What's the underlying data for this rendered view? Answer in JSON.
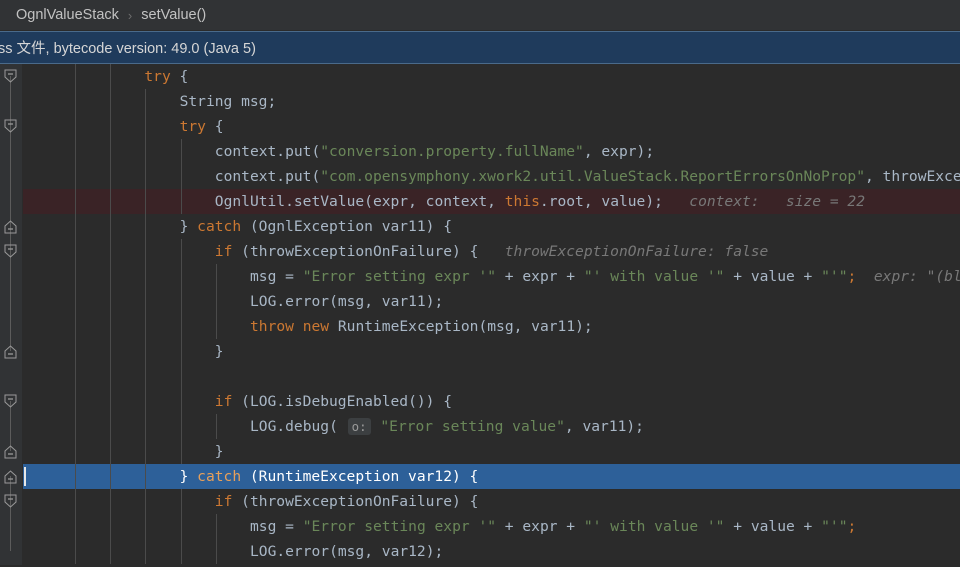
{
  "breadcrumb": {
    "name": "editor-breadcrumb",
    "items": [
      "OgnlValueStack",
      "setValue()"
    ],
    "separator": "›"
  },
  "infobar": {
    "text": "ss 文件, bytecode version: 49.0 (Java 5)",
    "background": "#1f3b5c",
    "border": "#4a6a8a"
  },
  "colors": {
    "editor_background": "#2b2b2b",
    "gutter_background": "#313335",
    "breadcrumb_background": "#313335",
    "default_text": "#a9b7c6",
    "keyword": "#cc7832",
    "string": "#6a8759",
    "number": "#6897bb",
    "inline_hint": "#787878",
    "execution_line": "#3a2326",
    "selected_line": "#2d6099",
    "indent_guide": "#4b4b4b",
    "fold_rail": "#5c5c5c"
  },
  "editor": {
    "name": "code-editor",
    "language": "java",
    "lines": [
      {
        "indent": 2,
        "guides": [
          1,
          2
        ],
        "state": "normal",
        "tokens": [
          {
            "t": "try",
            "c": "kw"
          },
          {
            "t": " {",
            "c": "pl"
          }
        ]
      },
      {
        "indent": 3,
        "guides": [
          1,
          2,
          3
        ],
        "state": "normal",
        "tokens": [
          {
            "t": "String msg;",
            "c": "pl"
          }
        ]
      },
      {
        "indent": 3,
        "guides": [
          1,
          2,
          3
        ],
        "state": "normal",
        "tokens": [
          {
            "t": "try",
            "c": "kw"
          },
          {
            "t": " {",
            "c": "pl"
          }
        ]
      },
      {
        "indent": 4,
        "guides": [
          1,
          2,
          3,
          4
        ],
        "state": "normal",
        "tokens": [
          {
            "t": "context.put(",
            "c": "pl"
          },
          {
            "t": "\"conversion.property.fullName\"",
            "c": "str"
          },
          {
            "t": ", expr);",
            "c": "pl"
          }
        ]
      },
      {
        "indent": 4,
        "guides": [
          1,
          2,
          3,
          4
        ],
        "state": "normal",
        "tokens": [
          {
            "t": "context.put(",
            "c": "pl"
          },
          {
            "t": "\"com.opensymphony.xwork2.util.ValueStack.ReportErrorsOnNoProp\"",
            "c": "str"
          },
          {
            "t": ", throwExceptio",
            "c": "pl"
          }
        ]
      },
      {
        "indent": 4,
        "guides": [
          1,
          2,
          3,
          4
        ],
        "state": "exec",
        "tokens": [
          {
            "t": "OgnlUtil.setValue(expr, context, ",
            "c": "pl"
          },
          {
            "t": "this",
            "c": "kw"
          },
          {
            "t": ".root, value);",
            "c": "pl"
          },
          {
            "t": "   context:   size = 22",
            "c": "hint"
          }
        ]
      },
      {
        "indent": 3,
        "guides": [
          1,
          2,
          3
        ],
        "state": "normal",
        "tokens": [
          {
            "t": "} ",
            "c": "pl"
          },
          {
            "t": "catch",
            "c": "kw"
          },
          {
            "t": " (OgnlException var11) {",
            "c": "pl"
          }
        ]
      },
      {
        "indent": 4,
        "guides": [
          1,
          2,
          3,
          4
        ],
        "state": "normal",
        "tokens": [
          {
            "t": "if",
            "c": "kw"
          },
          {
            "t": " (throwExceptionOnFailure) {",
            "c": "pl"
          },
          {
            "t": "   throwExceptionOnFailure: false",
            "c": "hint"
          }
        ]
      },
      {
        "indent": 5,
        "guides": [
          1,
          2,
          3,
          4,
          5
        ],
        "state": "normal",
        "tokens": [
          {
            "t": "msg = ",
            "c": "pl"
          },
          {
            "t": "\"Error setting expr '\"",
            "c": "str"
          },
          {
            "t": " + expr + ",
            "c": "pl"
          },
          {
            "t": "\"' with value '\"",
            "c": "str"
          },
          {
            "t": " + value + ",
            "c": "pl"
          },
          {
            "t": "\"'\"",
            "c": "str"
          },
          {
            "t": ";",
            "c": "sc"
          },
          {
            "t": "  expr: \"(bla)(b",
            "c": "hint"
          }
        ]
      },
      {
        "indent": 5,
        "guides": [
          1,
          2,
          3,
          4,
          5
        ],
        "state": "normal",
        "tokens": [
          {
            "t": "LOG.error(msg, var11);",
            "c": "pl"
          }
        ]
      },
      {
        "indent": 5,
        "guides": [
          1,
          2,
          3,
          4,
          5
        ],
        "state": "normal",
        "tokens": [
          {
            "t": "throw",
            "c": "kw"
          },
          {
            "t": " ",
            "c": "pl"
          },
          {
            "t": "new",
            "c": "kw"
          },
          {
            "t": " RuntimeException(msg, var11);",
            "c": "pl"
          }
        ]
      },
      {
        "indent": 4,
        "guides": [
          1,
          2,
          3,
          4
        ],
        "state": "normal",
        "tokens": [
          {
            "t": "}",
            "c": "pl"
          }
        ]
      },
      {
        "indent": 4,
        "guides": [
          1,
          2,
          3,
          4
        ],
        "state": "normal",
        "tokens": []
      },
      {
        "indent": 4,
        "guides": [
          1,
          2,
          3,
          4
        ],
        "state": "normal",
        "tokens": [
          {
            "t": "if",
            "c": "kw"
          },
          {
            "t": " (LOG.isDebugEnabled()) {",
            "c": "pl"
          }
        ]
      },
      {
        "indent": 5,
        "guides": [
          1,
          2,
          3,
          4,
          5
        ],
        "state": "normal",
        "tokens": [
          {
            "t": "LOG.debug( ",
            "c": "pl"
          },
          {
            "t": "o:",
            "c": "phint"
          },
          {
            "t": " ",
            "c": "pl"
          },
          {
            "t": "\"Error setting value\"",
            "c": "str"
          },
          {
            "t": ", var11);",
            "c": "pl"
          }
        ]
      },
      {
        "indent": 4,
        "guides": [
          1,
          2,
          3,
          4
        ],
        "state": "normal",
        "tokens": [
          {
            "t": "}",
            "c": "pl"
          }
        ]
      },
      {
        "indent": 3,
        "guides": [
          1,
          2,
          3
        ],
        "state": "selected",
        "caret": true,
        "tokens": [
          {
            "t": "} ",
            "c": "pl"
          },
          {
            "t": "catch",
            "c": "kw"
          },
          {
            "t": " (RuntimeException var12) {",
            "c": "pl"
          }
        ]
      },
      {
        "indent": 4,
        "guides": [
          1,
          2,
          3,
          4
        ],
        "state": "normal",
        "tokens": [
          {
            "t": "if",
            "c": "kw"
          },
          {
            "t": " (throwExceptionOnFailure) {",
            "c": "pl"
          }
        ]
      },
      {
        "indent": 5,
        "guides": [
          1,
          2,
          3,
          4,
          5
        ],
        "state": "normal",
        "tokens": [
          {
            "t": "msg = ",
            "c": "pl"
          },
          {
            "t": "\"Error setting expr '\"",
            "c": "str"
          },
          {
            "t": " + expr + ",
            "c": "pl"
          },
          {
            "t": "\"' with value '\"",
            "c": "str"
          },
          {
            "t": " + value + ",
            "c": "pl"
          },
          {
            "t": "\"'\"",
            "c": "str"
          },
          {
            "t": ";",
            "c": "sc"
          }
        ]
      },
      {
        "indent": 5,
        "guides": [
          1,
          2,
          3,
          4,
          5
        ],
        "state": "normal",
        "tokens": [
          {
            "t": "LOG.error(msg, var12);",
            "c": "pl"
          }
        ]
      }
    ],
    "fold_markers": [
      {
        "row": 0,
        "type": "expanded-start"
      },
      {
        "row": 2,
        "type": "expanded-start"
      },
      {
        "row": 6,
        "type": "expanded-end"
      },
      {
        "row": 7,
        "type": "expanded-start"
      },
      {
        "row": 11,
        "type": "expanded-end"
      },
      {
        "row": 13,
        "type": "expanded-start"
      },
      {
        "row": 15,
        "type": "expanded-end"
      },
      {
        "row": 16,
        "type": "expanded-end"
      },
      {
        "row": 17,
        "type": "expanded-start"
      }
    ],
    "fold_rails": [
      {
        "from_row": 0,
        "to_row": 6
      },
      {
        "from_row": 2,
        "to_row": 11
      },
      {
        "from_row": 13,
        "to_row": 15
      },
      {
        "from_row": 16,
        "to_row": 19
      }
    ]
  }
}
